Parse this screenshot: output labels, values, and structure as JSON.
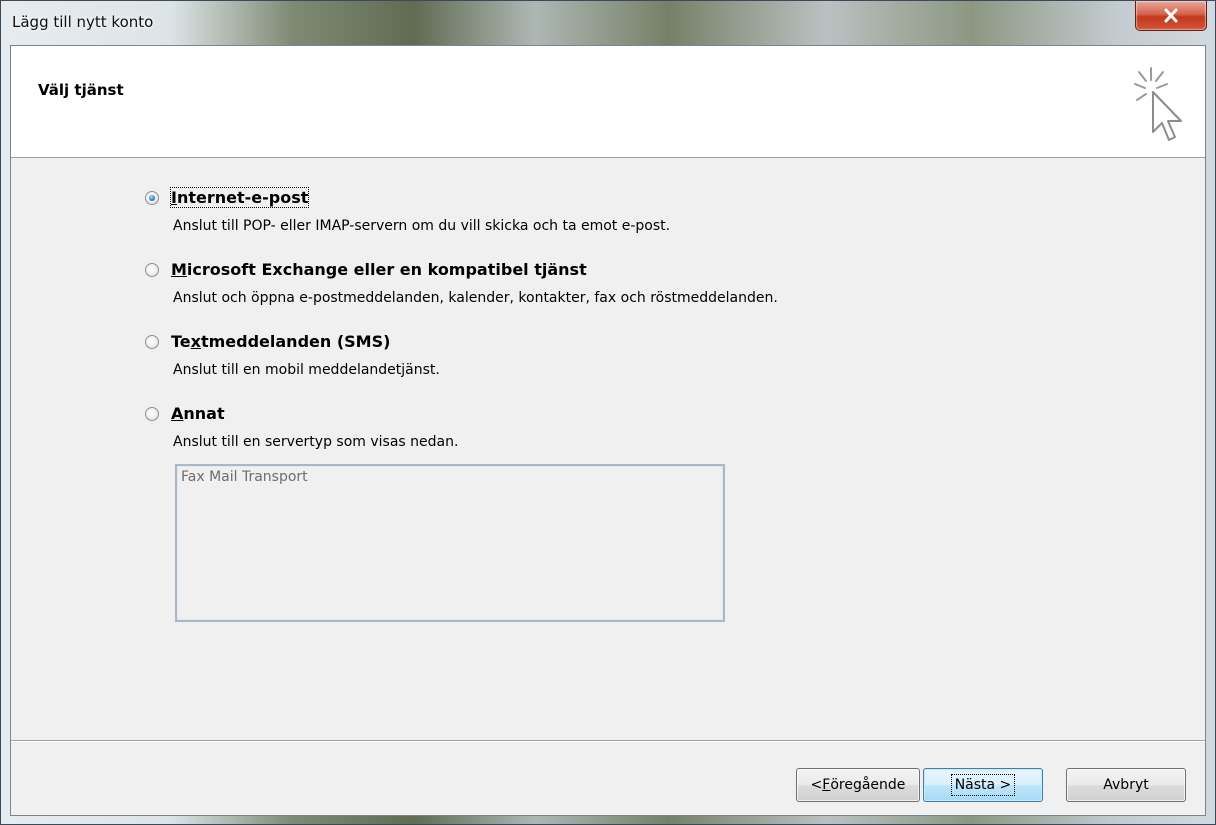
{
  "window": {
    "title": "Lägg till nytt konto"
  },
  "header": {
    "title": "Välj tjänst"
  },
  "options": [
    {
      "pre": "",
      "key": "I",
      "post": "nternet-e-post",
      "description": "Anslut till POP- eller IMAP-servern om du vill skicka och ta emot e-post.",
      "checked": true
    },
    {
      "pre": "",
      "key": "M",
      "post": "icrosoft Exchange eller en kompatibel tjänst",
      "description": "Anslut och öppna e-postmeddelanden, kalender, kontakter, fax och röstmeddelanden.",
      "checked": false
    },
    {
      "pre": "Te",
      "key": "x",
      "post": "tmeddelanden (SMS)",
      "description": "Anslut till en mobil meddelandetjänst.",
      "checked": false
    },
    {
      "pre": "",
      "key": "A",
      "post": "nnat",
      "description": "Anslut till en servertyp som visas nedan.",
      "checked": false
    }
  ],
  "server_list": {
    "items": [
      "Fax Mail Transport"
    ]
  },
  "buttons": {
    "back_pre": "< ",
    "back_key": "F",
    "back_post": "öregående",
    "next": "Nästa >",
    "cancel": "Avbryt"
  },
  "colors": {
    "close_button": "#c2391c",
    "default_button": "#3c7fb1",
    "client_bg": "#f0f0f0"
  }
}
